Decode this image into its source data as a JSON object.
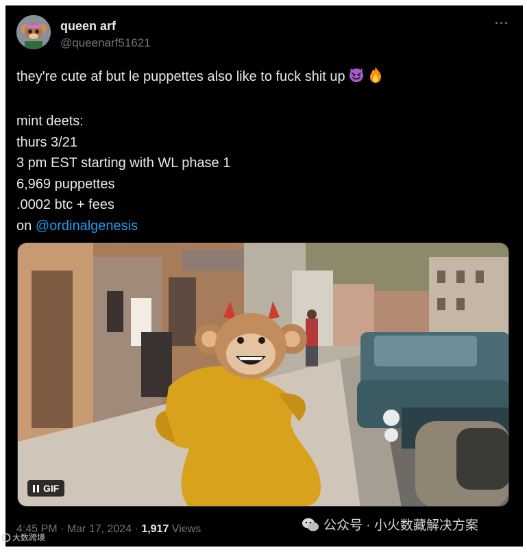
{
  "tweet": {
    "author": {
      "display_name": "queen arf",
      "handle": "@queenarf51621",
      "avatar_icon": "monkey-avatar-icon"
    },
    "more_label": "···",
    "text_lines": [
      "they're cute af but le puppettes also like to fuck shit up",
      "",
      "mint deets:",
      "thurs 3/21",
      "3 pm EST starting with WL phase 1",
      "6,969 puppettes",
      ".0002 btc + fees"
    ],
    "last_line_prefix": "on ",
    "mention": "@ordinalgenesis",
    "emojis": [
      "smiling-devil-emoji",
      "fire-emoji"
    ],
    "media": {
      "type": "GIF",
      "badge_label": "GIF"
    },
    "meta": {
      "time": "4:45 PM",
      "separator": " · ",
      "date": "Mar 17, 2024",
      "views_count": "1,917",
      "views_label": " Views"
    }
  },
  "watermark": {
    "text": "公众号 · 小火数藏解决方案",
    "logo_text": "大数跨境"
  },
  "colors": {
    "background": "#000000",
    "text": "#e7e9ea",
    "muted": "#71767b",
    "link": "#1d9bf0"
  }
}
